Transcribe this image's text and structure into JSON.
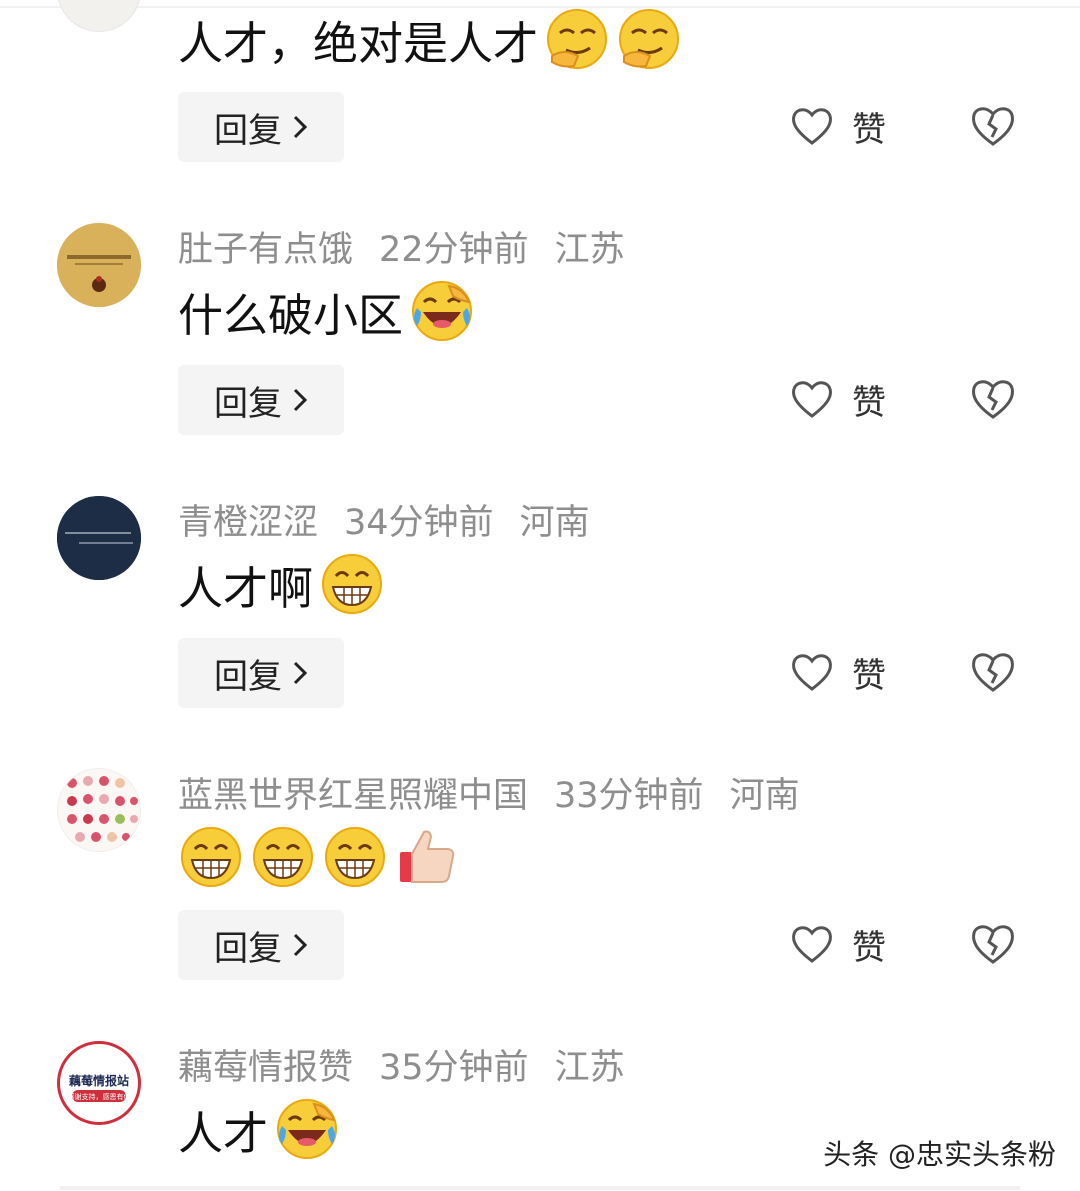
{
  "comments": [
    {
      "username": "",
      "time": "",
      "region": "",
      "text": "人才，绝对是人才",
      "emojis": [
        "smirk-face-icon",
        "smirk-face-icon"
      ],
      "reply_label": "回复",
      "like_label": "赞"
    },
    {
      "username": "肚子有点饿",
      "time": "22分钟前",
      "region": "江苏",
      "text": "什么破小区",
      "emojis": [
        "laugh-cry-face-icon"
      ],
      "reply_label": "回复",
      "like_label": "赞"
    },
    {
      "username": "青橙涩涩",
      "time": "34分钟前",
      "region": "河南",
      "text": "人才啊",
      "emojis": [
        "grin-face-icon"
      ],
      "reply_label": "回复",
      "like_label": "赞"
    },
    {
      "username": "蓝黑世界红星照耀中国",
      "time": "33分钟前",
      "region": "河南",
      "text": "",
      "emojis": [
        "grin-face-icon",
        "grin-face-icon",
        "grin-face-icon",
        "thumbs-up-icon"
      ],
      "reply_label": "回复",
      "like_label": "赞"
    },
    {
      "username": "藕莓情报赞",
      "time": "35分钟前",
      "region": "江苏",
      "text": "人才",
      "emojis": [
        "laugh-cry-face-icon"
      ],
      "reply_label": "",
      "like_label": ""
    }
  ],
  "avatar_badge": {
    "title": "藕莓情报站",
    "subtitle": "感谢支持，感恩有你"
  },
  "watermark": "头条 @忠实头条粉",
  "colors": {
    "meta_gray": "#8e8e8e",
    "button_bg": "#f4f4f4",
    "icon_gray": "#555555"
  }
}
